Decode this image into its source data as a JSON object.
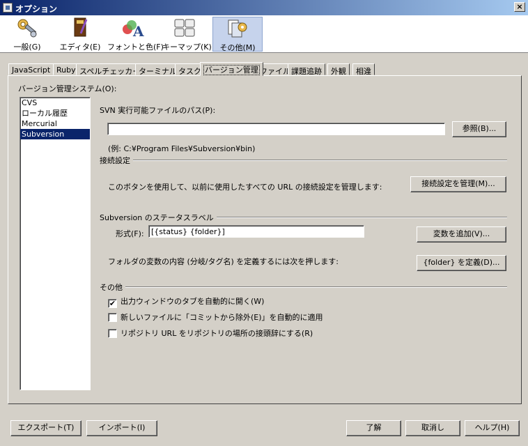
{
  "window": {
    "title": "オプション",
    "close": "×"
  },
  "categories": [
    {
      "label": "一般(G)",
      "icon": "wrench-gear-icon"
    },
    {
      "label": "エディタ(E)",
      "icon": "editor-book-icon"
    },
    {
      "label": "フォントと色(F)",
      "icon": "font-color-icon"
    },
    {
      "label": "キーマップ(K)",
      "icon": "keyboard-icon"
    },
    {
      "label": "その他(M)",
      "icon": "misc-icon",
      "selected": true
    }
  ],
  "tabs": [
    "JavaScript",
    "Ruby",
    "スペルチェッカー",
    "ターミナル",
    "タスク",
    "バージョン管理",
    "ファイル",
    "課題追跡",
    "外観",
    "相違"
  ],
  "active_tab": "バージョン管理",
  "vcs": {
    "system_label": "バージョン管理システム(O):",
    "systems": [
      "CVS",
      "ローカル履歴",
      "Mercurial",
      "Subversion"
    ],
    "selected": "Subversion"
  },
  "svn": {
    "path_label": "SVN 実行可能ファイルのパス(P):",
    "path_value": "",
    "browse_button": "参照(B)...",
    "example": "(例: C:¥Program Files¥Subversion¥bin)"
  },
  "connection": {
    "section_title": "接続設定",
    "description": "このボタンを使用して、以前に使用したすべての URL の接続設定を管理します:",
    "manage_button": "接続設定を管理(M)..."
  },
  "status_label": {
    "section_title": "Subversion のステータスラベル",
    "format_label": "形式(F):",
    "format_value": "[{status} {folder}]",
    "add_var_button": "変数を追加(V)...",
    "folder_desc": "フォルダの変数の内容 (分岐/タグ名) を定義するには次を押します:",
    "define_button": "{folder} を定義(D)..."
  },
  "other": {
    "section_title": "その他",
    "options": [
      {
        "label": "出力ウィンドウのタブを自動的に開く(W)",
        "checked": true
      },
      {
        "label": "新しいファイルに「コミットから除外(E)」を自動的に適用",
        "checked": false
      },
      {
        "label": "リポジトリ URL をリポジトリの場所の接頭辞にする(R)",
        "checked": false
      }
    ]
  },
  "footer": {
    "export": "エクスポート(T)",
    "import": "インポート(I)",
    "ok": "了解",
    "cancel": "取消し",
    "help": "ヘルプ(H)"
  }
}
